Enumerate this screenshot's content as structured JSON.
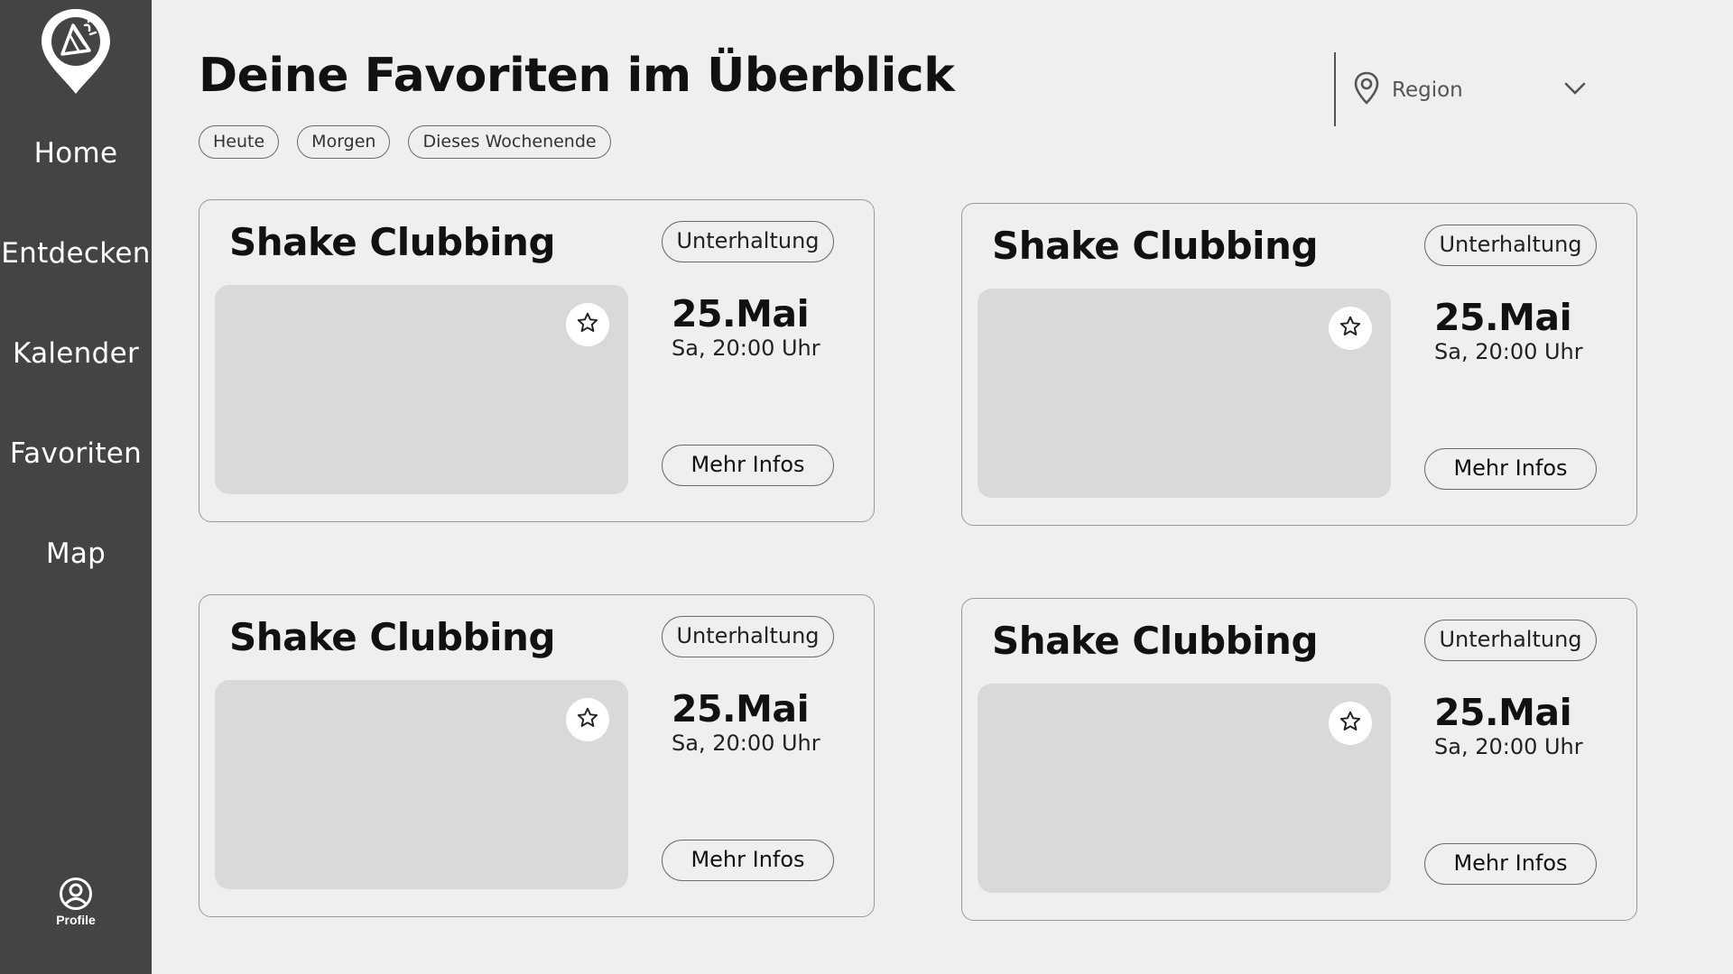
{
  "sidebar": {
    "logo_icon": "location-pin-party-icon",
    "items": [
      {
        "label": "Home"
      },
      {
        "label": "Entdecken"
      },
      {
        "label": "Kalender"
      },
      {
        "label": "Favoriten"
      },
      {
        "label": "Map"
      }
    ],
    "profile_label": "Profile",
    "background_color": "#444444"
  },
  "header": {
    "title": "Deine Favoriten im Überblick",
    "filters": [
      {
        "label": "Heute"
      },
      {
        "label": "Morgen"
      },
      {
        "label": "Dieses Wochenende"
      }
    ],
    "region": {
      "label": "Region",
      "icon": "location-pin-icon",
      "dropdown_icon": "chevron-down-icon"
    }
  },
  "cards": [
    {
      "title": "Shake Clubbing",
      "category": "Unterhaltung",
      "date": "25.Mai",
      "time": "Sa, 20:00 Uhr",
      "button_label": "Mehr Infos",
      "favorite_icon": "star-icon"
    },
    {
      "title": "Shake Clubbing",
      "category": "Unterhaltung",
      "date": "25.Mai",
      "time": "Sa, 20:00 Uhr",
      "button_label": "Mehr Infos",
      "favorite_icon": "star-icon"
    },
    {
      "title": "Shake Clubbing",
      "category": "Unterhaltung",
      "date": "25.Mai",
      "time": "Sa, 20:00 Uhr",
      "button_label": "Mehr Infos",
      "favorite_icon": "star-icon"
    },
    {
      "title": "Shake Clubbing",
      "category": "Unterhaltung",
      "date": "25.Mai",
      "time": "Sa, 20:00 Uhr",
      "button_label": "Mehr Infos",
      "favorite_icon": "star-icon"
    }
  ]
}
